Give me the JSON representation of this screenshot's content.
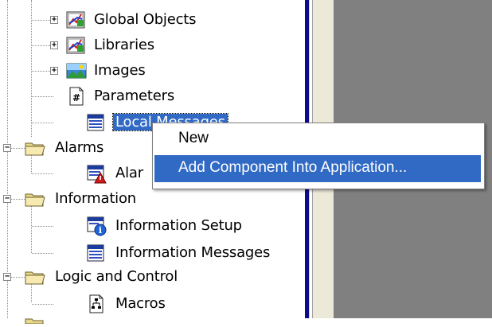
{
  "tree": {
    "nodes": [
      {
        "label": "Global Objects",
        "icon": "global-objects-icon"
      },
      {
        "label": "Libraries",
        "icon": "libraries-icon"
      },
      {
        "label": "Images",
        "icon": "images-icon"
      },
      {
        "label": "Parameters",
        "icon": "parameters-icon"
      },
      {
        "label": "Local Messages",
        "icon": "messages-icon"
      },
      {
        "label": "Alarms",
        "icon": "folder-icon"
      },
      {
        "label": "Alar",
        "icon": "alarm-icon"
      },
      {
        "label": "Information",
        "icon": "folder-icon"
      },
      {
        "label": "Information Setup",
        "icon": "information-setup-icon"
      },
      {
        "label": "Information Messages",
        "icon": "messages-icon"
      },
      {
        "label": "Logic and Control",
        "icon": "folder-icon"
      },
      {
        "label": "Macros",
        "icon": "macros-icon"
      }
    ]
  },
  "context_menu": {
    "items": [
      {
        "label": "New"
      },
      {
        "label": "Add Component Into Application..."
      }
    ]
  },
  "colors": {
    "selection": "#316ac5",
    "divider": "#0a0a8a",
    "pane": "#808080"
  }
}
